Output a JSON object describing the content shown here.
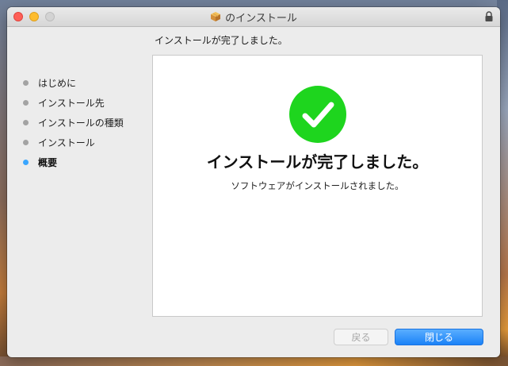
{
  "window": {
    "title": "のインストール",
    "icons": {
      "title": "package-icon",
      "lock": "lock-icon"
    }
  },
  "header": {
    "text": "インストールが完了しました。"
  },
  "sidebar": {
    "steps": [
      {
        "label": "はじめに"
      },
      {
        "label": "インストール先"
      },
      {
        "label": "インストールの種類"
      },
      {
        "label": "インストール"
      },
      {
        "label": "概要",
        "active": true
      }
    ]
  },
  "content": {
    "title": "インストールが完了しました。",
    "subtitle": "ソフトウェアがインストールされました。",
    "icon": "checkmark-icon",
    "success_color": "#1ed51e"
  },
  "buttons": {
    "back_label": "戻る",
    "close_label": "閉じる"
  },
  "colors": {
    "accent": "#1b82f7",
    "active_step_dot": "#3aa6ff"
  }
}
